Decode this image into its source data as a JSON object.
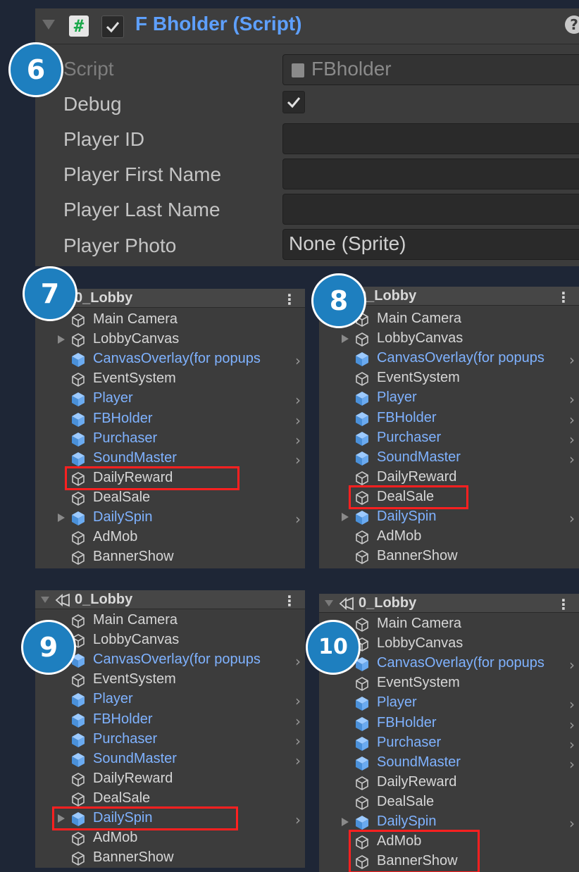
{
  "inspector": {
    "title": "F Bholder (Script)",
    "help_glyph": "?",
    "check_glyph": "✓",
    "properties": [
      {
        "label": "Script",
        "value": "FBholder",
        "disabled": true
      },
      {
        "label": "Debug",
        "value": "✓"
      },
      {
        "label": "Player ID",
        "value": ""
      },
      {
        "label": "Player First Name",
        "value": ""
      },
      {
        "label": "Player Last Name",
        "value": ""
      },
      {
        "label": "Player Photo",
        "value": "None (Sprite)"
      }
    ]
  },
  "badges": [
    "6",
    "7",
    "8",
    "9",
    "10"
  ],
  "hierarchy": {
    "scene_name": "0_Lobby",
    "kebab": "⋮",
    "chevron": "›",
    "items": [
      {
        "label": "Main Camera",
        "prefab": false,
        "expandable": false,
        "chevron": false
      },
      {
        "label": "LobbyCanvas",
        "prefab": false,
        "expandable": true,
        "chevron": false
      },
      {
        "label": "CanvasOverlay(for popups",
        "prefab": true,
        "expandable": false,
        "chevron": true
      },
      {
        "label": "EventSystem",
        "prefab": false,
        "expandable": false,
        "chevron": false
      },
      {
        "label": "Player",
        "prefab": true,
        "expandable": false,
        "chevron": true
      },
      {
        "label": "FBHolder",
        "prefab": true,
        "expandable": false,
        "chevron": true
      },
      {
        "label": "Purchaser",
        "prefab": true,
        "expandable": false,
        "chevron": true
      },
      {
        "label": "SoundMaster",
        "prefab": true,
        "expandable": false,
        "chevron": true
      },
      {
        "label": "DailyReward",
        "prefab": false,
        "expandable": false,
        "chevron": false
      },
      {
        "label": "DealSale",
        "prefab": false,
        "expandable": false,
        "chevron": false
      },
      {
        "label": "DailySpin",
        "prefab": true,
        "expandable": true,
        "chevron": true
      },
      {
        "label": "AdMob",
        "prefab": false,
        "expandable": false,
        "chevron": false
      },
      {
        "label": "BannerShow",
        "prefab": false,
        "expandable": false,
        "chevron": false
      }
    ]
  },
  "colors": {
    "background": "#1e2636",
    "panel": "#3c3c3c",
    "prefab_text": "#7fb2ff",
    "highlight": "#ff2020",
    "badge": "#1e7fbf"
  }
}
